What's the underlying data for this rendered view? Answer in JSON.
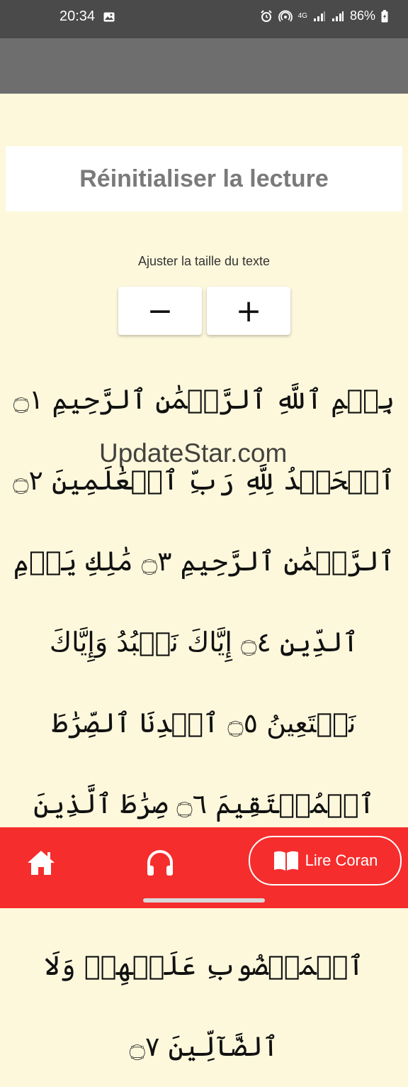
{
  "status_bar": {
    "time": "20:34",
    "network": "4G",
    "battery": "86%",
    "icons": [
      "image-icon",
      "alarm-icon",
      "hotspot-icon",
      "signal-icon",
      "battery-icon"
    ]
  },
  "reset_button": {
    "label": "Réinitialiser la lecture"
  },
  "text_size": {
    "label": "Ajuster la taille du texte",
    "decrease_label": "−",
    "increase_label": "+"
  },
  "surah": {
    "text": "بِسۡمِ ٱللَّهِ ٱلرَّحۡمَٰنِ ٱلرَّحِيمِ ۝١ ٱلۡحَمۡدُ لِلَّهِ رَبِّ ٱلۡعَٰلَمِينَ ۝٢ ٱلرَّحۡمَٰنِ ٱلرَّحِيمِ ۝٣ مَٰلِكِ يَوۡمِ ٱلدِّينِ ۝٤ إِيَّاكَ نَعۡبُدُ وَإِيَّاكَ نَسۡتَعِينُ ۝٥ ٱهۡدِنَا ٱلصِّرَٰطَ ٱلۡمُسۡتَقِيمَ ۝٦ صِرَٰطَ ٱلَّذِينَ أَنۡعَمۡتَ عَلَيۡهِمۡ غَيۡرِ ٱلۡمَغۡضُوبِ عَلَيۡهِمۡ وَلَا ٱلضَّآلِّينَ ۝٧"
  },
  "watermark": "UpdateStar.com",
  "bottom_nav": {
    "read_label": "Lire Coran"
  },
  "colors": {
    "background": "#fdf8dc",
    "app_bar": "#6e6e6e",
    "nav_bar": "#f62d2d"
  }
}
